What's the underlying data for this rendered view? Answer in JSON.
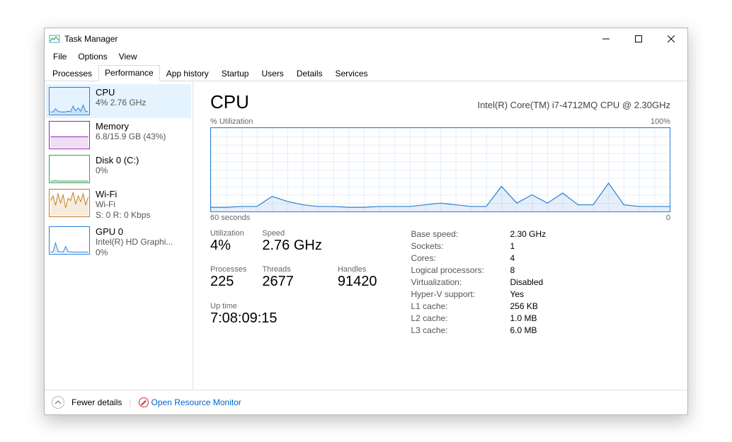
{
  "window": {
    "title": "Task Manager"
  },
  "menu": {
    "file": "File",
    "options": "Options",
    "view": "View"
  },
  "tabs": [
    "Processes",
    "Performance",
    "App history",
    "Startup",
    "Users",
    "Details",
    "Services"
  ],
  "activeTab": 1,
  "sidebar": [
    {
      "title": "CPU",
      "sub1": "4% 2.76 GHz",
      "sub2": "",
      "color": "#2a7fd4",
      "selected": true
    },
    {
      "title": "Memory",
      "sub1": "6.8/15.9 GB (43%)",
      "sub2": "",
      "color": "#8c2ab3"
    },
    {
      "title": "Disk 0 (C:)",
      "sub1": "0%",
      "sub2": "",
      "color": "#2aa34a"
    },
    {
      "title": "Wi-Fi",
      "sub1": "Wi-Fi",
      "sub2": "S: 0  R: 0 Kbps",
      "color": "#c47a1a"
    },
    {
      "title": "GPU 0",
      "sub1": "Intel(R) HD Graphi...",
      "sub2": "0%",
      "color": "#2a7fd4"
    }
  ],
  "main": {
    "title": "CPU",
    "chipname": "Intel(R) Core(TM) i7-4712MQ CPU @ 2.30GHz",
    "chart_top_left": "% Utilization",
    "chart_top_right": "100%",
    "chart_bot_left": "60 seconds",
    "chart_bot_right": "0",
    "stats": {
      "utilization_label": "Utilization",
      "utilization": "4%",
      "speed_label": "Speed",
      "speed": "2.76 GHz",
      "processes_label": "Processes",
      "processes": "225",
      "threads_label": "Threads",
      "threads": "2677",
      "handles_label": "Handles",
      "handles": "91420",
      "uptime_label": "Up time",
      "uptime": "7:08:09:15"
    },
    "right": [
      [
        "Base speed:",
        "2.30 GHz"
      ],
      [
        "Sockets:",
        "1"
      ],
      [
        "Cores:",
        "4"
      ],
      [
        "Logical processors:",
        "8"
      ],
      [
        "Virtualization:",
        "Disabled"
      ],
      [
        "Hyper-V support:",
        "Yes"
      ],
      [
        "L1 cache:",
        "256 KB"
      ],
      [
        "L2 cache:",
        "1.0 MB"
      ],
      [
        "L3 cache:",
        "6.0 MB"
      ]
    ]
  },
  "footer": {
    "fewer": "Fewer details",
    "rm": "Open Resource Monitor"
  },
  "chart_data": {
    "type": "line",
    "title": "CPU % Utilization",
    "xlabel": "60 seconds → 0",
    "ylabel": "% Utilization",
    "ylim": [
      0,
      100
    ],
    "x_sec_ago": [
      60,
      58,
      56,
      54,
      52,
      50,
      48,
      46,
      44,
      42,
      40,
      38,
      36,
      34,
      32,
      30,
      28,
      26,
      24,
      22,
      20,
      18,
      16,
      14,
      12,
      10,
      8,
      6,
      4,
      2,
      0
    ],
    "values": [
      5,
      5,
      6,
      6,
      18,
      12,
      8,
      6,
      6,
      5,
      5,
      6,
      6,
      6,
      8,
      10,
      8,
      6,
      6,
      30,
      10,
      20,
      10,
      22,
      8,
      8,
      34,
      8,
      6,
      6,
      6
    ]
  },
  "thumb_sparklines": {
    "cpu": [
      5,
      6,
      18,
      8,
      6,
      5,
      6,
      8,
      6,
      30,
      10,
      22,
      8,
      34,
      8,
      6
    ],
    "memory": [
      43,
      43,
      43,
      43,
      43,
      43,
      43,
      43,
      43,
      43,
      43,
      43,
      43,
      43,
      43,
      43
    ],
    "disk": [
      0,
      0,
      2,
      0,
      0,
      0,
      0,
      0,
      0,
      0,
      0,
      0,
      0,
      0,
      0,
      0
    ],
    "wifi": [
      60,
      80,
      40,
      90,
      50,
      85,
      30,
      70,
      60,
      95,
      45,
      80,
      55,
      88,
      42,
      75
    ],
    "gpu": [
      2,
      3,
      40,
      5,
      3,
      2,
      25,
      4,
      3,
      2,
      3,
      2,
      2,
      3,
      2,
      2
    ]
  }
}
